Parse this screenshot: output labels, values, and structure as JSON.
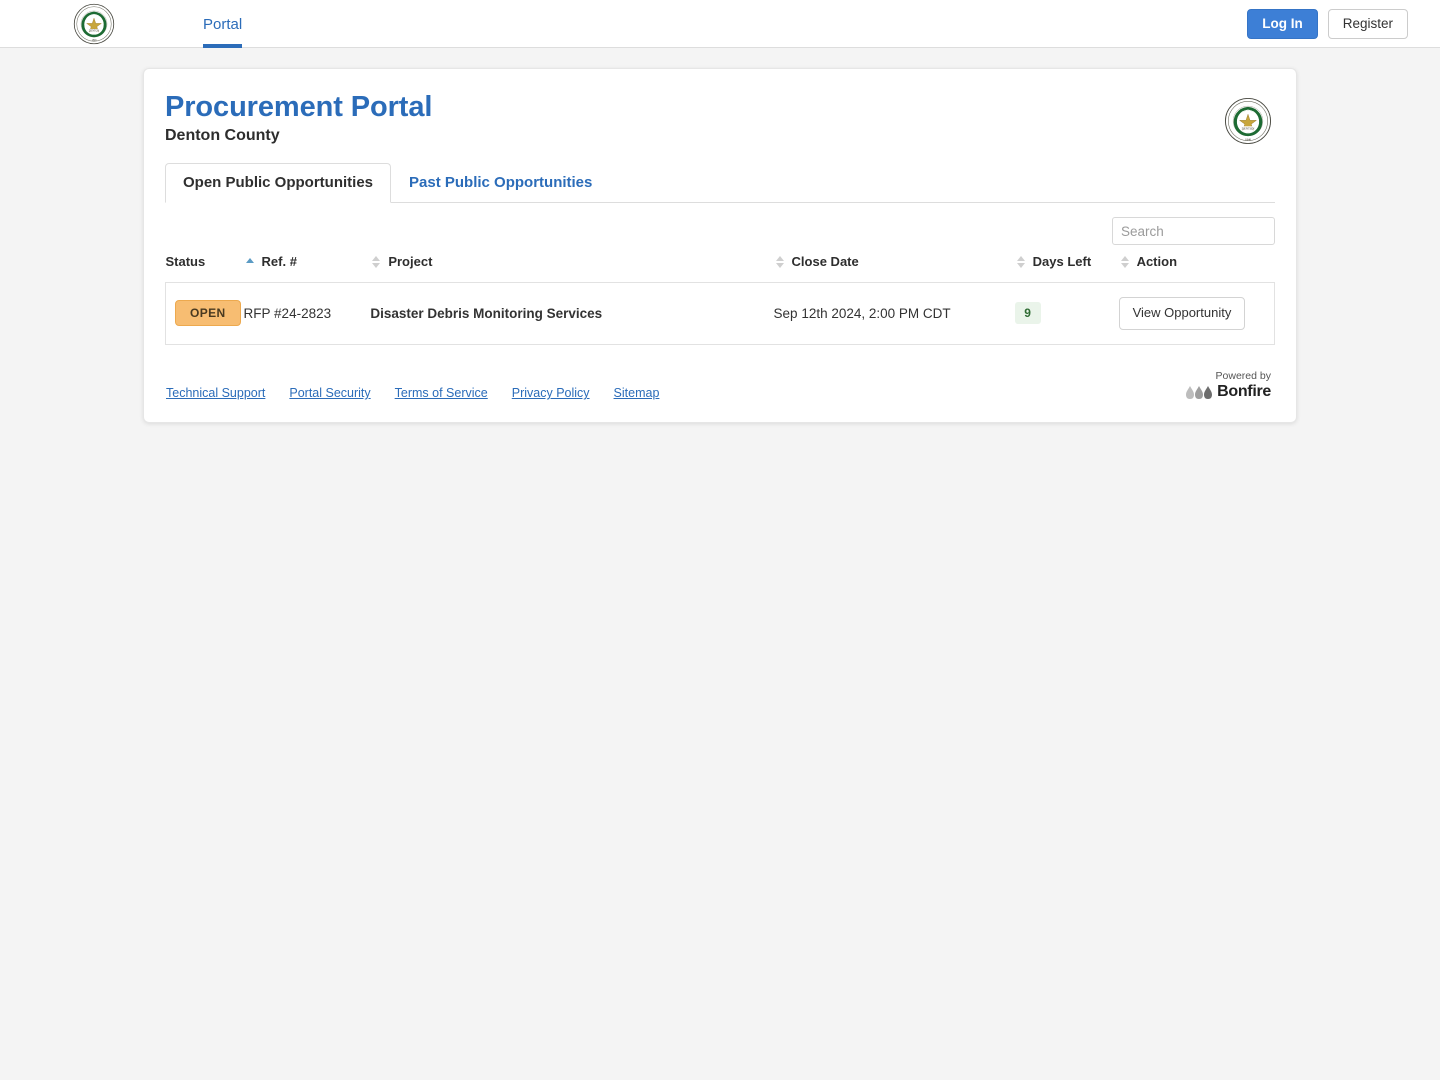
{
  "navbar": {
    "brand_icon": "denton-county-seal",
    "links": [
      {
        "label": "Portal",
        "active": true
      }
    ],
    "login_label": "Log In",
    "register_label": "Register"
  },
  "card": {
    "title": "Procurement Portal",
    "subtitle": "Denton County",
    "seal_icon": "denton-county-seal"
  },
  "tabs": [
    {
      "label": "Open Public Opportunities",
      "active": true
    },
    {
      "label": "Past Public Opportunities",
      "active": false
    }
  ],
  "search": {
    "placeholder": "Search",
    "value": ""
  },
  "table": {
    "columns": [
      {
        "label": "Status",
        "sort": "asc"
      },
      {
        "label": "Ref. #",
        "sort": "none"
      },
      {
        "label": "Project",
        "sort": "none"
      },
      {
        "label": "Close Date",
        "sort": "none"
      },
      {
        "label": "Days Left",
        "sort": "none"
      },
      {
        "label": "Action",
        "sort": "none"
      }
    ],
    "rows": [
      {
        "status": "OPEN",
        "ref": "RFP #24-2823",
        "project": "Disaster Debris Monitoring Services",
        "close_date": "Sep 12th 2024, 2:00 PM CDT",
        "days_left": "9",
        "action_label": "View Opportunity"
      }
    ]
  },
  "footer": {
    "links": [
      {
        "label": "Technical Support"
      },
      {
        "label": "Portal Security"
      },
      {
        "label": "Terms of Service"
      },
      {
        "label": "Privacy Policy"
      },
      {
        "label": "Sitemap"
      }
    ],
    "powered_by_label": "Powered by",
    "powered_by_brand": "Bonfire"
  },
  "colors": {
    "accent_blue": "#2b6cb9",
    "login_blue": "#3d7fd6",
    "status_open_bg": "#f7bd72",
    "days_left_bg": "#eaf4ea",
    "days_left_text": "#2f6b33",
    "page_bg": "#f4f4f4"
  }
}
